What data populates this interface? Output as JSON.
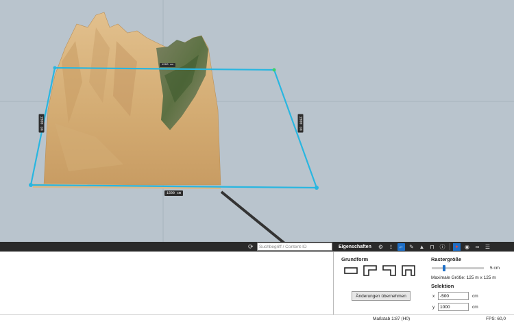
{
  "viewport": {
    "dim_bottom": "1500 cm",
    "dim_left": "1500 cm",
    "dim_right": "1500 cm",
    "dim_top": "1500 cm"
  },
  "toolbar": {
    "search_placeholder": "Suchbegriff / Content-ID",
    "panel_title": "Eigenschaften",
    "icons": [
      "settings-icon",
      "transform-icon",
      "floorplan-icon",
      "paint-icon",
      "terrain-icon",
      "object-icon",
      "info-icon",
      "pin-icon",
      "eye-icon",
      "link-icon",
      "menu-icon"
    ]
  },
  "properties": {
    "grundform_title": "Grundform",
    "shapes": [
      "rectangle-shape",
      "l-shape",
      "angle-shape",
      "u-shape"
    ],
    "apply_label": "Änderungen übernehmen",
    "raster_title": "Rastergröße",
    "raster_value": "5 cm",
    "raster_fraction": 0.22,
    "max_size": "Maximale Größe: 125 m x 125 m",
    "selektion_title": "Selektion",
    "x_label": "x",
    "y_label": "y",
    "x_value": "-500",
    "y_value": "1000",
    "unit": "cm"
  },
  "status": {
    "scale": "Maßstab 1:87 (H0)",
    "fps": "FPS: 60,0"
  },
  "colors": {
    "selection": "#29b6e0",
    "accent": "#1e6fc7",
    "terrain": "#d7b27a"
  }
}
